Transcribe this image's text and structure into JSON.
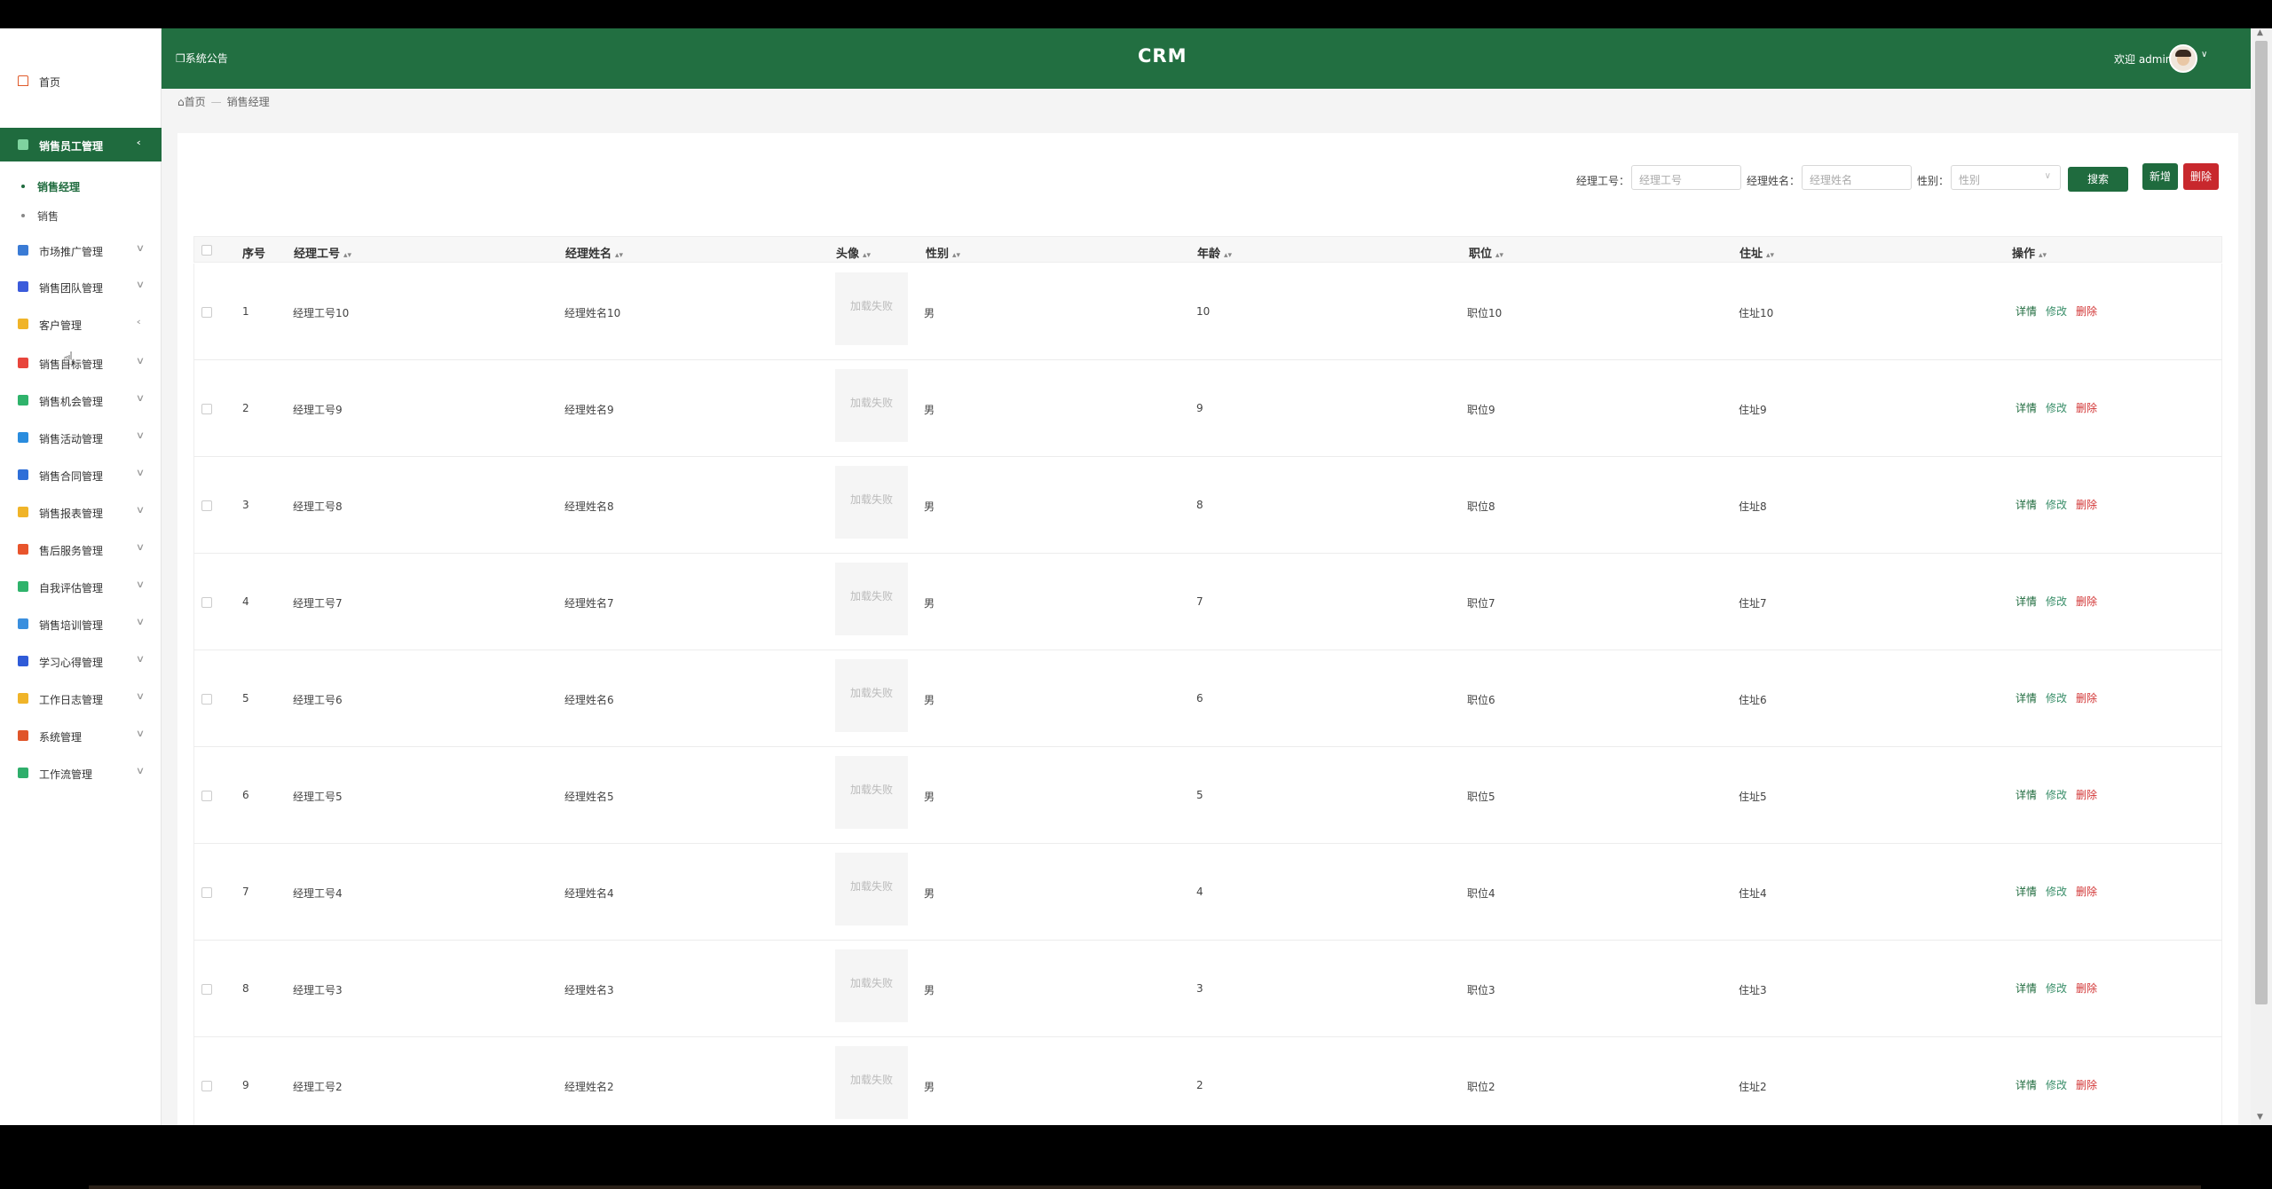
{
  "app": {
    "title": "CRM"
  },
  "header": {
    "notice": "系统公告",
    "welcome": "欢迎 admin"
  },
  "sidebar": {
    "home": "首页",
    "active_group": "销售员工管理",
    "sub_items": [
      "销售经理",
      "销售"
    ],
    "groups": [
      {
        "label": "市场推广管理",
        "color": "#3a7bd5"
      },
      {
        "label": "销售团队管理",
        "color": "#3b5bdb"
      },
      {
        "label": "客户管理",
        "color": "#f0b429"
      },
      {
        "label": "销售目标管理",
        "color": "#e8453c"
      },
      {
        "label": "销售机会管理",
        "color": "#2fb36b"
      },
      {
        "label": "销售活动管理",
        "color": "#2a8cde"
      },
      {
        "label": "销售合同管理",
        "color": "#2f6fd8"
      },
      {
        "label": "销售报表管理",
        "color": "#f0b429"
      },
      {
        "label": "售后服务管理",
        "color": "#e8542c"
      },
      {
        "label": "自我评估管理",
        "color": "#2fb36b"
      },
      {
        "label": "销售培训管理",
        "color": "#3a8fde"
      },
      {
        "label": "学习心得管理",
        "color": "#2f5bd8"
      },
      {
        "label": "工作日志管理",
        "color": "#f0b429"
      },
      {
        "label": "系统管理",
        "color": "#e0552a"
      },
      {
        "label": "工作流管理",
        "color": "#2fae6b"
      }
    ]
  },
  "breadcrumb": {
    "home": "首页",
    "current": "销售经理"
  },
  "search": {
    "id_label": "经理工号：",
    "id_placeholder": "经理工号",
    "name_label": "经理姓名：",
    "name_placeholder": "经理姓名",
    "gender_label": "性别：",
    "gender_placeholder": "性别",
    "search_btn": "搜索",
    "add_btn": "新增",
    "delete_btn": "删除"
  },
  "table": {
    "headers": {
      "index": "序号",
      "id": "经理工号",
      "name": "经理姓名",
      "avatar": "头像",
      "gender": "性别",
      "age": "年龄",
      "position": "职位",
      "address": "住址",
      "actions": "操作"
    },
    "avatar_failed": "加载失败",
    "actions": {
      "detail": "详情",
      "edit": "修改",
      "delete": "删除"
    },
    "rows": [
      {
        "index": "1",
        "id": "经理工号10",
        "name": "经理姓名10",
        "gender": "男",
        "age": "10",
        "position": "职位10",
        "address": "住址10"
      },
      {
        "index": "2",
        "id": "经理工号9",
        "name": "经理姓名9",
        "gender": "男",
        "age": "9",
        "position": "职位9",
        "address": "住址9"
      },
      {
        "index": "3",
        "id": "经理工号8",
        "name": "经理姓名8",
        "gender": "男",
        "age": "8",
        "position": "职位8",
        "address": "住址8"
      },
      {
        "index": "4",
        "id": "经理工号7",
        "name": "经理姓名7",
        "gender": "男",
        "age": "7",
        "position": "职位7",
        "address": "住址7"
      },
      {
        "index": "5",
        "id": "经理工号6",
        "name": "经理姓名6",
        "gender": "男",
        "age": "6",
        "position": "职位6",
        "address": "住址6"
      },
      {
        "index": "6",
        "id": "经理工号5",
        "name": "经理姓名5",
        "gender": "男",
        "age": "5",
        "position": "职位5",
        "address": "住址5"
      },
      {
        "index": "7",
        "id": "经理工号4",
        "name": "经理姓名4",
        "gender": "男",
        "age": "4",
        "position": "职位4",
        "address": "住址4"
      },
      {
        "index": "8",
        "id": "经理工号3",
        "name": "经理姓名3",
        "gender": "男",
        "age": "3",
        "position": "职位3",
        "address": "住址3"
      },
      {
        "index": "9",
        "id": "经理工号2",
        "name": "经理姓名2",
        "gender": "男",
        "age": "2",
        "position": "职位2",
        "address": "住址2"
      }
    ]
  },
  "colors": {
    "primary": "#226f41",
    "danger": "#c8282d"
  }
}
